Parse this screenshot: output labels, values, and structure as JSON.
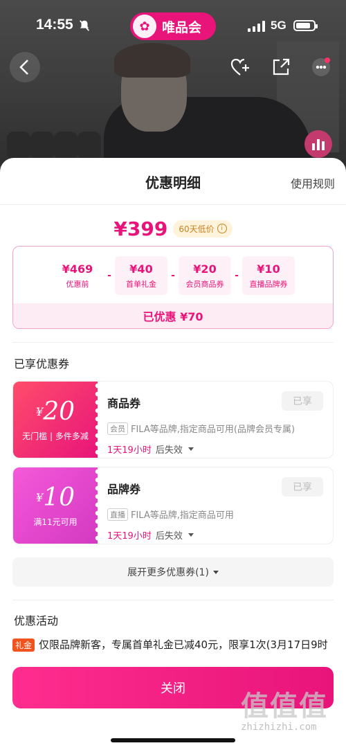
{
  "status_bar": {
    "time": "14:55",
    "network": "5G",
    "app_brand": "唯品会"
  },
  "sheet": {
    "title": "优惠明细",
    "rules_link": "使用规则"
  },
  "price": {
    "final": "¥399",
    "low_tag": "60天低价"
  },
  "breakdown": {
    "items": [
      {
        "amount": "¥469",
        "label": "优惠前"
      },
      {
        "amount": "¥40",
        "label": "首单礼金"
      },
      {
        "amount": "¥20",
        "label": "会员商品券"
      },
      {
        "amount": "¥10",
        "label": "直播品牌券"
      }
    ],
    "ops": [
      "-",
      "-",
      "-"
    ],
    "total": "已优惠 ¥70"
  },
  "coupons_section": {
    "title": "已享优惠券"
  },
  "coupons": [
    {
      "symbol": "¥",
      "value": "20",
      "condition": "无门槛 | 多件多减",
      "name": "商品券",
      "status": "已享",
      "badge": "会员",
      "desc": "FILA等品牌,指定商品可用(品牌会员专属)",
      "expiry_time": "1天19小时",
      "expiry_suffix": "后失效"
    },
    {
      "symbol": "¥",
      "value": "10",
      "condition": "满11元可用",
      "name": "品牌券",
      "status": "已享",
      "badge": "直播",
      "desc": "FILA等品牌,指定商品可用",
      "expiry_time": "1天19小时",
      "expiry_suffix": "后失效"
    }
  ],
  "expand_more": "展开更多优惠券(1)",
  "activities": {
    "title": "优惠活动",
    "tag": "礼金",
    "text": "仅限品牌新客，专属首单礼金已减40元，限享1次(3月17日9时"
  },
  "close_button": "关闭",
  "watermark": {
    "big": "值值值",
    "small": "zhizhizhi.com"
  },
  "colors": {
    "accent": "#e8147a",
    "tag_orange": "#f0531d",
    "gold": "#c8821e"
  }
}
